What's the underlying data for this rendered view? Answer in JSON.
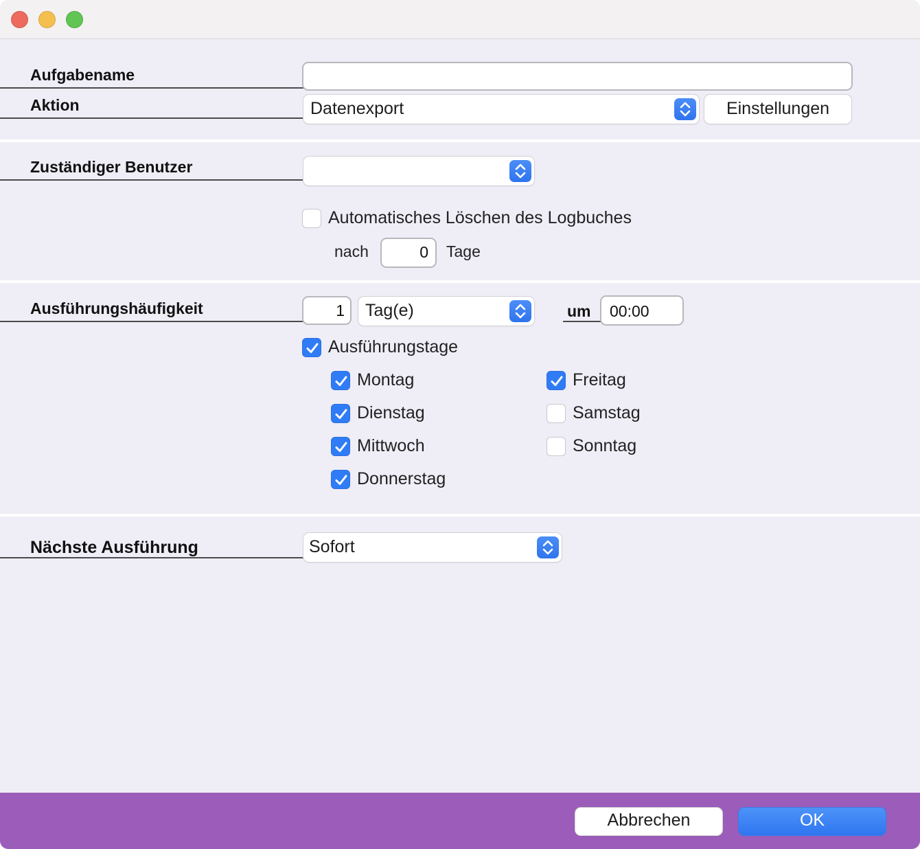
{
  "form": {
    "task_name_label": "Aufgabename",
    "task_name_value": "",
    "action_label": "Aktion",
    "action_value": "Datenexport",
    "settings_button": "Einstellungen",
    "user_label": "Zuständiger Benutzer",
    "user_value": "",
    "auto_delete_label": "Automatisches Löschen des Logbuches",
    "auto_delete_checked": false,
    "after_label": "nach",
    "after_days": "0",
    "days_unit": "Tage",
    "frequency_label": "Ausführungshäufigkeit",
    "frequency_count": "1",
    "frequency_unit": "Tag(e)",
    "at_label": "um",
    "time_value": "00:00",
    "exec_days_label": "Ausführungstage",
    "exec_days_checked": true,
    "days": [
      {
        "label": "Montag",
        "checked": true
      },
      {
        "label": "Dienstag",
        "checked": true
      },
      {
        "label": "Mittwoch",
        "checked": true
      },
      {
        "label": "Donnerstag",
        "checked": true
      },
      {
        "label": "Freitag",
        "checked": true
      },
      {
        "label": "Samstag",
        "checked": false
      },
      {
        "label": "Sonntag",
        "checked": false
      }
    ],
    "next_exec_label": "Nächste Ausführung",
    "next_exec_value": "Sofort"
  },
  "footer": {
    "cancel_button": "Abbrechen",
    "ok_button": "OK"
  },
  "colors": {
    "accent": "#2f7cf6",
    "footer_bg": "#9b5db9",
    "window_bg": "#efedf6"
  }
}
